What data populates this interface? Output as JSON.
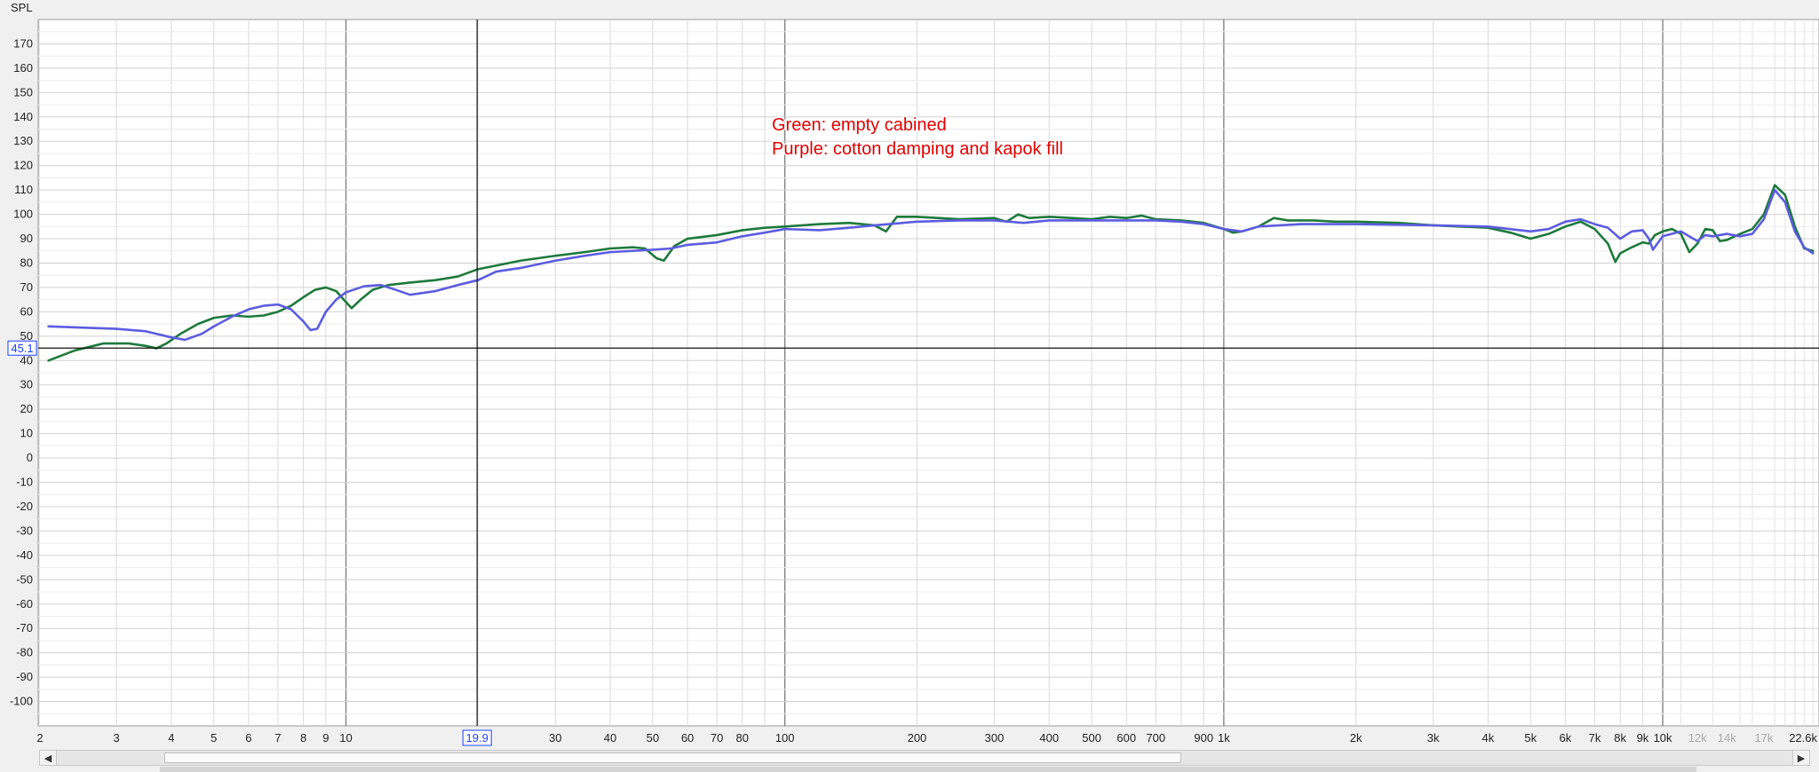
{
  "chart_data": {
    "type": "line",
    "ylabel": "SPL",
    "xscale": "log",
    "xlim": [
      1.99,
      22700
    ],
    "ylim": [
      -110,
      180
    ],
    "grid": true,
    "y_ticks": [
      170,
      160,
      150,
      140,
      130,
      120,
      110,
      100,
      90,
      80,
      70,
      60,
      50,
      40,
      30,
      20,
      10,
      0,
      -10,
      -20,
      -30,
      -40,
      -50,
      -60,
      -70,
      -80,
      -90,
      -100
    ],
    "x_ticks": [
      {
        "v": 2,
        "label": "2"
      },
      {
        "v": 3,
        "label": "3"
      },
      {
        "v": 4,
        "label": "4"
      },
      {
        "v": 5,
        "label": "5"
      },
      {
        "v": 6,
        "label": "6"
      },
      {
        "v": 7,
        "label": "7"
      },
      {
        "v": 8,
        "label": "8"
      },
      {
        "v": 9,
        "label": "9"
      },
      {
        "v": 10,
        "label": "10"
      },
      {
        "v": 30,
        "label": "30"
      },
      {
        "v": 40,
        "label": "40"
      },
      {
        "v": 50,
        "label": "50"
      },
      {
        "v": 60,
        "label": "60"
      },
      {
        "v": 70,
        "label": "70"
      },
      {
        "v": 80,
        "label": "80"
      },
      {
        "v": 100,
        "label": "100"
      },
      {
        "v": 200,
        "label": "200"
      },
      {
        "v": 300,
        "label": "300"
      },
      {
        "v": 400,
        "label": "400"
      },
      {
        "v": 500,
        "label": "500"
      },
      {
        "v": 600,
        "label": "600"
      },
      {
        "v": 700,
        "label": "700"
      },
      {
        "v": 900,
        "label": "900"
      },
      {
        "v": 1000,
        "label": "1k"
      },
      {
        "v": 2000,
        "label": "2k"
      },
      {
        "v": 3000,
        "label": "3k"
      },
      {
        "v": 4000,
        "label": "4k"
      },
      {
        "v": 5000,
        "label": "5k"
      },
      {
        "v": 6000,
        "label": "6k"
      },
      {
        "v": 7000,
        "label": "7k"
      },
      {
        "v": 8000,
        "label": "8k"
      },
      {
        "v": 9000,
        "label": "9k"
      },
      {
        "v": 10000,
        "label": "10k"
      },
      {
        "v": 12000,
        "label": "12k",
        "light": true
      },
      {
        "v": 14000,
        "label": "14k",
        "light": true
      },
      {
        "v": 17000,
        "label": "17k",
        "light": true
      },
      {
        "v": 22600,
        "label": "22.6k"
      }
    ],
    "cursor": {
      "x": 19.9,
      "y": 45.1,
      "x_label": "19.9",
      "y_label": "45.1"
    },
    "annotations": [
      "Green: empty cabined",
      "Purple: cotton damping and kapok fill"
    ],
    "series": [
      {
        "color": "#1e7a3c",
        "points": [
          [
            2.1,
            40
          ],
          [
            2.4,
            44
          ],
          [
            2.8,
            47
          ],
          [
            3.2,
            47
          ],
          [
            3.5,
            46
          ],
          [
            3.7,
            45
          ],
          [
            3.9,
            47
          ],
          [
            4.2,
            51
          ],
          [
            4.6,
            55
          ],
          [
            5,
            57.5
          ],
          [
            5.5,
            58.5
          ],
          [
            6,
            58
          ],
          [
            6.5,
            58.5
          ],
          [
            7,
            60
          ],
          [
            7.5,
            62.5
          ],
          [
            8,
            66
          ],
          [
            8.5,
            69
          ],
          [
            9,
            70
          ],
          [
            9.5,
            68.5
          ],
          [
            10,
            64
          ],
          [
            10.3,
            61.5
          ],
          [
            10.8,
            65
          ],
          [
            11.5,
            69
          ],
          [
            12.5,
            71
          ],
          [
            14,
            72
          ],
          [
            16,
            73
          ],
          [
            18,
            74.5
          ],
          [
            20,
            77.5
          ],
          [
            22,
            79
          ],
          [
            25,
            81
          ],
          [
            30,
            83
          ],
          [
            35,
            84.5
          ],
          [
            40,
            86
          ],
          [
            45,
            86.5
          ],
          [
            48,
            86
          ],
          [
            51,
            82
          ],
          [
            53,
            81
          ],
          [
            56,
            87
          ],
          [
            60,
            90
          ],
          [
            70,
            91.5
          ],
          [
            80,
            93.5
          ],
          [
            90,
            94.5
          ],
          [
            100,
            95
          ],
          [
            120,
            96
          ],
          [
            140,
            96.5
          ],
          [
            160,
            95.5
          ],
          [
            170,
            93
          ],
          [
            180,
            99
          ],
          [
            200,
            99
          ],
          [
            250,
            98
          ],
          [
            300,
            98.5
          ],
          [
            320,
            97
          ],
          [
            340,
            100
          ],
          [
            360,
            98.5
          ],
          [
            400,
            99
          ],
          [
            450,
            98.5
          ],
          [
            500,
            98
          ],
          [
            550,
            99
          ],
          [
            600,
            98.5
          ],
          [
            650,
            99.5
          ],
          [
            700,
            98
          ],
          [
            800,
            97.5
          ],
          [
            900,
            96.5
          ],
          [
            1000,
            94
          ],
          [
            1050,
            92.5
          ],
          [
            1100,
            93
          ],
          [
            1200,
            95
          ],
          [
            1300,
            98.5
          ],
          [
            1400,
            97.5
          ],
          [
            1600,
            97.5
          ],
          [
            1800,
            97
          ],
          [
            2000,
            97
          ],
          [
            2500,
            96.5
          ],
          [
            3000,
            95.5
          ],
          [
            4000,
            94.5
          ],
          [
            4500,
            92.5
          ],
          [
            5000,
            90
          ],
          [
            5500,
            92
          ],
          [
            6000,
            95
          ],
          [
            6500,
            97
          ],
          [
            7000,
            94
          ],
          [
            7500,
            88
          ],
          [
            7800,
            80.5
          ],
          [
            8000,
            84
          ],
          [
            8500,
            86.5
          ],
          [
            9000,
            88.5
          ],
          [
            9300,
            88
          ],
          [
            9600,
            91.5
          ],
          [
            10000,
            93
          ],
          [
            10500,
            94
          ],
          [
            11000,
            92
          ],
          [
            11500,
            84.5
          ],
          [
            12000,
            88
          ],
          [
            12500,
            94
          ],
          [
            13000,
            93.5
          ],
          [
            13500,
            89
          ],
          [
            14000,
            89.5
          ],
          [
            15000,
            92
          ],
          [
            16000,
            94
          ],
          [
            17000,
            100
          ],
          [
            18000,
            112
          ],
          [
            19000,
            108
          ],
          [
            20000,
            95
          ],
          [
            21000,
            86
          ],
          [
            22000,
            85
          ]
        ]
      },
      {
        "color": "#5c5ce0",
        "points": [
          [
            2.1,
            54
          ],
          [
            2.5,
            53.5
          ],
          [
            3,
            53
          ],
          [
            3.5,
            52
          ],
          [
            4,
            49.5
          ],
          [
            4.3,
            48.5
          ],
          [
            4.7,
            51
          ],
          [
            5,
            54
          ],
          [
            5.5,
            58
          ],
          [
            6,
            61
          ],
          [
            6.5,
            62.5
          ],
          [
            7,
            63
          ],
          [
            7.5,
            61
          ],
          [
            8,
            56
          ],
          [
            8.3,
            52.5
          ],
          [
            8.6,
            53
          ],
          [
            9,
            60
          ],
          [
            9.5,
            65
          ],
          [
            10,
            68
          ],
          [
            11,
            70.5
          ],
          [
            12,
            71
          ],
          [
            13,
            69
          ],
          [
            14,
            67
          ],
          [
            16,
            68.5
          ],
          [
            18,
            71
          ],
          [
            20,
            73
          ],
          [
            22,
            76.5
          ],
          [
            25,
            78
          ],
          [
            30,
            81
          ],
          [
            35,
            83
          ],
          [
            40,
            84.5
          ],
          [
            50,
            85.5
          ],
          [
            55,
            86
          ],
          [
            60,
            87.5
          ],
          [
            70,
            88.5
          ],
          [
            80,
            91
          ],
          [
            90,
            92.5
          ],
          [
            100,
            94
          ],
          [
            120,
            93.5
          ],
          [
            140,
            94.5
          ],
          [
            160,
            95.5
          ],
          [
            200,
            97
          ],
          [
            250,
            97.5
          ],
          [
            300,
            97.5
          ],
          [
            350,
            96.5
          ],
          [
            400,
            97.5
          ],
          [
            500,
            97.5
          ],
          [
            600,
            97.5
          ],
          [
            700,
            97.5
          ],
          [
            800,
            97
          ],
          [
            900,
            96
          ],
          [
            1000,
            94
          ],
          [
            1100,
            93
          ],
          [
            1200,
            95
          ],
          [
            1500,
            96
          ],
          [
            2000,
            96
          ],
          [
            3000,
            95.5
          ],
          [
            4000,
            95
          ],
          [
            5000,
            93
          ],
          [
            5500,
            94
          ],
          [
            6000,
            97
          ],
          [
            6500,
            98
          ],
          [
            7000,
            96
          ],
          [
            7500,
            94.5
          ],
          [
            8000,
            90
          ],
          [
            8500,
            93
          ],
          [
            9000,
            93.5
          ],
          [
            9300,
            90
          ],
          [
            9500,
            85.5
          ],
          [
            10000,
            91
          ],
          [
            11000,
            93
          ],
          [
            12000,
            89
          ],
          [
            12500,
            91.5
          ],
          [
            13000,
            91
          ],
          [
            14000,
            92
          ],
          [
            15000,
            91
          ],
          [
            16000,
            92
          ],
          [
            17000,
            98
          ],
          [
            18000,
            110
          ],
          [
            19000,
            105
          ],
          [
            20000,
            93
          ],
          [
            21000,
            86.5
          ],
          [
            22000,
            84
          ]
        ]
      }
    ]
  },
  "scrollbar": {
    "left_icon": "triangle-left-icon",
    "right_icon": "triangle-right-icon"
  }
}
